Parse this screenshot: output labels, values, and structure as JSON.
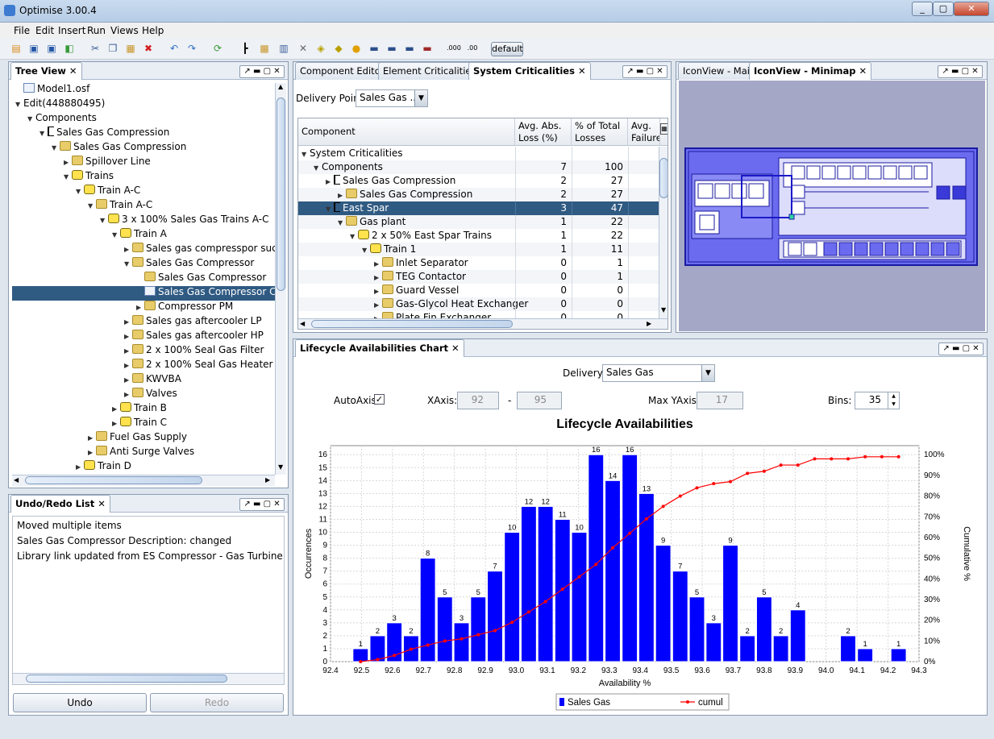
{
  "window": {
    "title": "Optimise 3.00.4"
  },
  "menu": [
    "File",
    "Edit",
    "Insert",
    "Run",
    "Views",
    "Help"
  ],
  "toolbar": {
    "profile": "default",
    "icons": [
      "new-icon",
      "save-icon",
      "save-as-icon",
      "open-icon",
      "cut-icon",
      "copy-icon",
      "paste-icon",
      "delete-icon",
      "undo-icon",
      "redo-icon",
      "refresh-icon",
      "node-icon",
      "component-icon",
      "library-icon",
      "tools-icon",
      "train-icon",
      "train-run-icon",
      "person-icon",
      "field-1-icon",
      "field-2-icon",
      "field-3-icon",
      "field-4-icon",
      "decimal-icon",
      "decimal-00-icon"
    ]
  },
  "tree_view": {
    "tab": "Tree View",
    "items": [
      {
        "label": "Model1.osf",
        "icon": "doc",
        "indent": 0,
        "tw": ""
      },
      {
        "label": "Edit(448880495)",
        "icon": "",
        "indent": 0,
        "tw": "▼"
      },
      {
        "label": "Components",
        "icon": "",
        "indent": 1,
        "tw": "▼"
      },
      {
        "label": "Sales Gas Compression",
        "icon": "node",
        "indent": 2,
        "tw": "▼"
      },
      {
        "label": "Sales Gas Compression",
        "icon": "folder",
        "indent": 3,
        "tw": "▼"
      },
      {
        "label": "Spillover Line",
        "icon": "folder",
        "indent": 4,
        "tw": "▶"
      },
      {
        "label": "Trains",
        "icon": "train",
        "indent": 4,
        "tw": "▼"
      },
      {
        "label": "Train A-C",
        "icon": "train",
        "indent": 5,
        "tw": "▼"
      },
      {
        "label": "Train A-C",
        "icon": "folder",
        "indent": 6,
        "tw": "▼"
      },
      {
        "label": "3 x 100% Sales Gas Trains A-C",
        "icon": "train",
        "indent": 7,
        "tw": "▼"
      },
      {
        "label": "Train A",
        "icon": "train",
        "indent": 8,
        "tw": "▼"
      },
      {
        "label": "Sales gas compresspor sucti",
        "icon": "folder",
        "indent": 9,
        "tw": "▶"
      },
      {
        "label": "Sales Gas Compressor",
        "icon": "folder",
        "indent": 9,
        "tw": "▼"
      },
      {
        "label": "Sales Gas Compressor",
        "icon": "folder",
        "indent": 10,
        "tw": ""
      },
      {
        "label": "Sales Gas Compressor Ch",
        "icon": "doc",
        "indent": 10,
        "tw": "",
        "selected": true
      },
      {
        "label": "Compressor PM",
        "icon": "folder",
        "indent": 10,
        "tw": "▶"
      },
      {
        "label": "Sales gas aftercooler LP",
        "icon": "folder",
        "indent": 9,
        "tw": "▶"
      },
      {
        "label": "Sales gas aftercooler HP",
        "icon": "folder",
        "indent": 9,
        "tw": "▶"
      },
      {
        "label": "2 x 100% Seal Gas Filter",
        "icon": "folder",
        "indent": 9,
        "tw": "▶"
      },
      {
        "label": "2 x 100% Seal Gas Heater",
        "icon": "folder",
        "indent": 9,
        "tw": "▶"
      },
      {
        "label": "KWVBA",
        "icon": "folder",
        "indent": 9,
        "tw": "▶"
      },
      {
        "label": "Valves",
        "icon": "folder",
        "indent": 9,
        "tw": "▶"
      },
      {
        "label": "Train B",
        "icon": "train",
        "indent": 8,
        "tw": "▶"
      },
      {
        "label": "Train C",
        "icon": "train",
        "indent": 8,
        "tw": "▶"
      },
      {
        "label": "Fuel Gas Supply",
        "icon": "folder",
        "indent": 6,
        "tw": "▶"
      },
      {
        "label": "Anti Surge Valves",
        "icon": "folder",
        "indent": 6,
        "tw": "▶"
      },
      {
        "label": "Train D",
        "icon": "train",
        "indent": 5,
        "tw": "▶"
      }
    ]
  },
  "undo_redo": {
    "tab": "Undo/Redo List",
    "items": [
      "Moved multiple items",
      "Sales Gas Compressor Description: changed",
      "Library link updated from ES Compressor - Gas Turbine Package"
    ],
    "undo_label": "Undo",
    "redo_label": "Redo"
  },
  "center_tabs": [
    "Component Editor",
    "Element Criticalities",
    "System Criticalities"
  ],
  "criticalities": {
    "delivery_point_label": "Delivery Point",
    "delivery_point_value": "Sales Gas ..",
    "columns": [
      "Component",
      "Avg. Abs. Loss (%)",
      "% of Total Losses",
      "Avg. Failure"
    ],
    "rows": [
      {
        "label": "System Criticalities",
        "icon": "",
        "indent": 0,
        "tw": "▼",
        "abs": "",
        "pct": ""
      },
      {
        "label": "Components",
        "icon": "",
        "indent": 1,
        "tw": "▼",
        "abs": "7",
        "pct": "100"
      },
      {
        "label": "Sales Gas Compression",
        "icon": "node",
        "indent": 2,
        "tw": "▶",
        "abs": "2",
        "pct": "27"
      },
      {
        "label": "Sales Gas Compression",
        "icon": "folder",
        "indent": 3,
        "tw": "▶",
        "abs": "2",
        "pct": "27"
      },
      {
        "label": "East Spar",
        "icon": "node",
        "indent": 2,
        "tw": "▼",
        "abs": "3",
        "pct": "47",
        "selected": true
      },
      {
        "label": "Gas plant",
        "icon": "folder",
        "indent": 3,
        "tw": "▼",
        "abs": "1",
        "pct": "22"
      },
      {
        "label": "2 x 50% East Spar Trains",
        "icon": "train",
        "indent": 4,
        "tw": "▼",
        "abs": "1",
        "pct": "22"
      },
      {
        "label": "Train 1",
        "icon": "train",
        "indent": 5,
        "tw": "▼",
        "abs": "1",
        "pct": "11"
      },
      {
        "label": "Inlet Separator",
        "icon": "folder",
        "indent": 6,
        "tw": "▶",
        "abs": "0",
        "pct": "1"
      },
      {
        "label": "TEG Contactor",
        "icon": "folder",
        "indent": 6,
        "tw": "▶",
        "abs": "0",
        "pct": "1"
      },
      {
        "label": "Guard Vessel",
        "icon": "folder",
        "indent": 6,
        "tw": "▶",
        "abs": "0",
        "pct": "0"
      },
      {
        "label": "Gas-Glycol Heat Exchanger",
        "icon": "folder",
        "indent": 6,
        "tw": "▶",
        "abs": "0",
        "pct": "0"
      },
      {
        "label": "Plate Fin Exchanger",
        "icon": "folder",
        "indent": 6,
        "tw": "▶",
        "abs": "0",
        "pct": "0"
      }
    ]
  },
  "right_tabs": [
    "IconView - Main",
    "IconView - Minimap"
  ],
  "lifecycle": {
    "tab": "Lifecycle Availabilities Chart",
    "delivery_label": "Delivery:",
    "delivery_value": "Sales Gas",
    "autoaxis_label": "AutoAxis",
    "xaxis_label": "XAxis:",
    "xaxis_min": "92",
    "xaxis_dash": "-",
    "xaxis_max": "95",
    "maxy_label": "Max YAxis:",
    "maxy_value": "17",
    "bins_label": "Bins:",
    "bins_value": "35"
  },
  "chart_data": {
    "type": "bar",
    "title": "Lifecycle Availabilities",
    "xlabel": "Availability %",
    "ylabel": "Occurrences",
    "y2label": "Cumulative %",
    "xlim": [
      92.4,
      94.3
    ],
    "ylim": [
      0,
      16.7
    ],
    "xticks": [
      92.4,
      92.5,
      92.6,
      92.7,
      92.8,
      92.9,
      93.0,
      93.1,
      93.2,
      93.3,
      93.4,
      93.5,
      93.6,
      93.7,
      93.8,
      93.9,
      94.0,
      94.1,
      94.2,
      94.3
    ],
    "xticklabels": [
      "92.4",
      "92.5",
      "92.6",
      "92.7",
      "92.8",
      "92.9",
      "93.0",
      "93.1",
      "93.2",
      "93.3",
      "93.4",
      "93.5",
      "93.6",
      "93.7",
      "93.8",
      "93.9",
      "94.0",
      "94.1",
      "94.2",
      "94.3"
    ],
    "yticks": [
      0,
      1,
      2,
      3,
      4,
      5,
      6,
      7,
      8,
      9,
      10,
      11,
      12,
      13,
      14,
      15,
      16
    ],
    "y2ticks": [
      "0%",
      "10%",
      "20%",
      "30%",
      "40%",
      "50%",
      "60%",
      "70%",
      "80%",
      "90%",
      "100%"
    ],
    "bin_width": 0.0543,
    "series": [
      {
        "name": "Sales Gas",
        "color": "#0000ff",
        "x": [
          92.497,
          92.552,
          92.606,
          92.66,
          92.714,
          92.769,
          92.823,
          92.877,
          92.931,
          92.986,
          93.04,
          93.094,
          93.149,
          93.203,
          93.257,
          93.311,
          93.366,
          93.42,
          93.474,
          93.529,
          93.583,
          93.637,
          93.691,
          93.746,
          93.8,
          93.854,
          93.909,
          93.963,
          94.017,
          94.071,
          94.126,
          94.18
        ],
        "values": [
          1,
          2,
          3,
          2,
          8,
          5,
          3,
          5,
          7,
          10,
          12,
          12,
          11,
          10,
          16,
          14,
          16,
          13,
          9,
          7,
          5,
          3,
          9,
          2,
          5,
          2,
          4,
          0,
          0,
          2,
          1,
          0
        ]
      },
      {
        "name": "cumul",
        "color": "#ff0000",
        "x": [
          92.497,
          92.552,
          92.606,
          92.66,
          92.714,
          92.769,
          92.823,
          92.877,
          92.931,
          92.986,
          93.04,
          93.094,
          93.149,
          93.203,
          93.257,
          93.311,
          93.366,
          93.42,
          93.474,
          93.529,
          93.583,
          93.637,
          93.691,
          93.746,
          93.8,
          93.854,
          93.909,
          93.963,
          94.017,
          94.071,
          94.126,
          94.18,
          94.234
        ],
        "values": [
          0,
          1,
          3,
          6,
          8,
          10,
          11,
          13,
          15,
          19,
          24,
          29,
          35,
          41,
          47,
          55,
          62,
          69,
          75,
          80,
          84,
          86,
          87,
          91,
          92,
          95,
          95,
          98,
          98,
          98,
          99,
          99,
          99
        ]
      }
    ],
    "extra_bar": {
      "x": 94.234,
      "value": 1
    },
    "legend": [
      "Sales Gas",
      "cumul"
    ]
  }
}
